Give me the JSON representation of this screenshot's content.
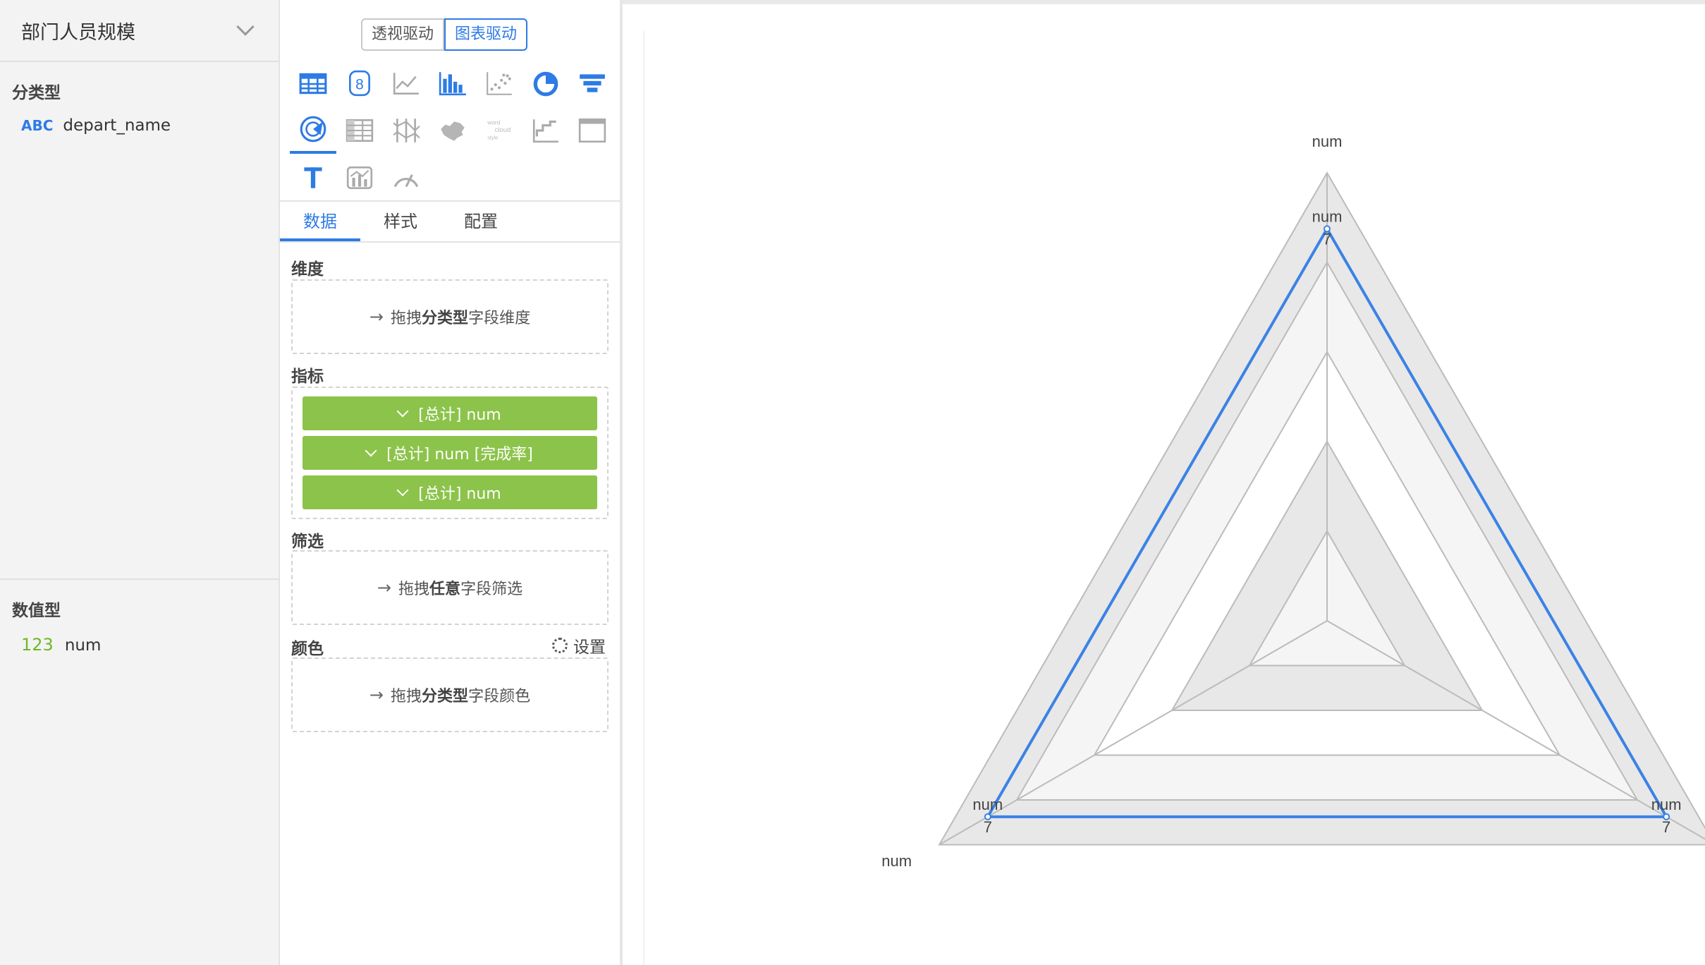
{
  "dataset": {
    "name": "部门人员规模"
  },
  "fields": {
    "dimension_title": "分类型",
    "dimensions": [
      {
        "type_tag": "ABC",
        "name": "depart_name"
      }
    ],
    "measure_title": "数值型",
    "measures": [
      {
        "type_tag": "123",
        "name": "num"
      }
    ]
  },
  "mode": {
    "pivot_label": "透视驱动",
    "chart_label": "图表驱动",
    "active": "chart"
  },
  "chart_types": [
    [
      "table-icon",
      "number-card-icon",
      "line-chart-icon",
      "bar-chart-icon",
      "scatter-chart-icon",
      "pie-chart-icon",
      "funnel-chart-icon"
    ],
    [
      "radar-chart-icon",
      "cross-table-icon",
      "parallel-icon",
      "china-map-icon",
      "word-cloud-icon",
      "step-chart-icon",
      "frame-icon"
    ],
    [
      "text-icon",
      "combo-chart-icon",
      "gauge-icon"
    ]
  ],
  "active_chart_type": "radar-chart-icon",
  "tabs": {
    "data": "数据",
    "style": "样式",
    "config": "配置",
    "active": "data"
  },
  "config": {
    "dimension_label": "维度",
    "dimension_hint_prefix": "拖拽",
    "dimension_hint_bold": "分类型",
    "dimension_hint_suffix": "字段维度",
    "metric_label": "指标",
    "metrics": [
      "[总计] num",
      "[总计] num [完成率]",
      "[总计] num"
    ],
    "filter_label": "筛选",
    "filter_hint_prefix": "拖拽",
    "filter_hint_bold": "任意",
    "filter_hint_suffix": "字段筛选",
    "color_label": "颜色",
    "color_settings": "设置",
    "color_hint_prefix": "拖拽",
    "color_hint_bold": "分类型",
    "color_hint_suffix": "字段颜色"
  },
  "chart_data": {
    "type": "radar",
    "indicators": [
      "num",
      "num",
      "num"
    ],
    "indicator_max": 8,
    "split_number": 5,
    "series": [
      {
        "values": [
          7,
          7,
          7
        ]
      }
    ],
    "point_labels": [
      "num",
      "num",
      "num"
    ],
    "value_labels": [
      "7",
      "7",
      "7"
    ],
    "line_color": "#3b82e6",
    "split_area_colors": [
      "#ffffff",
      "#f5f5f5",
      "#e8e8e8"
    ],
    "grid_color": "#bbbbbb"
  }
}
